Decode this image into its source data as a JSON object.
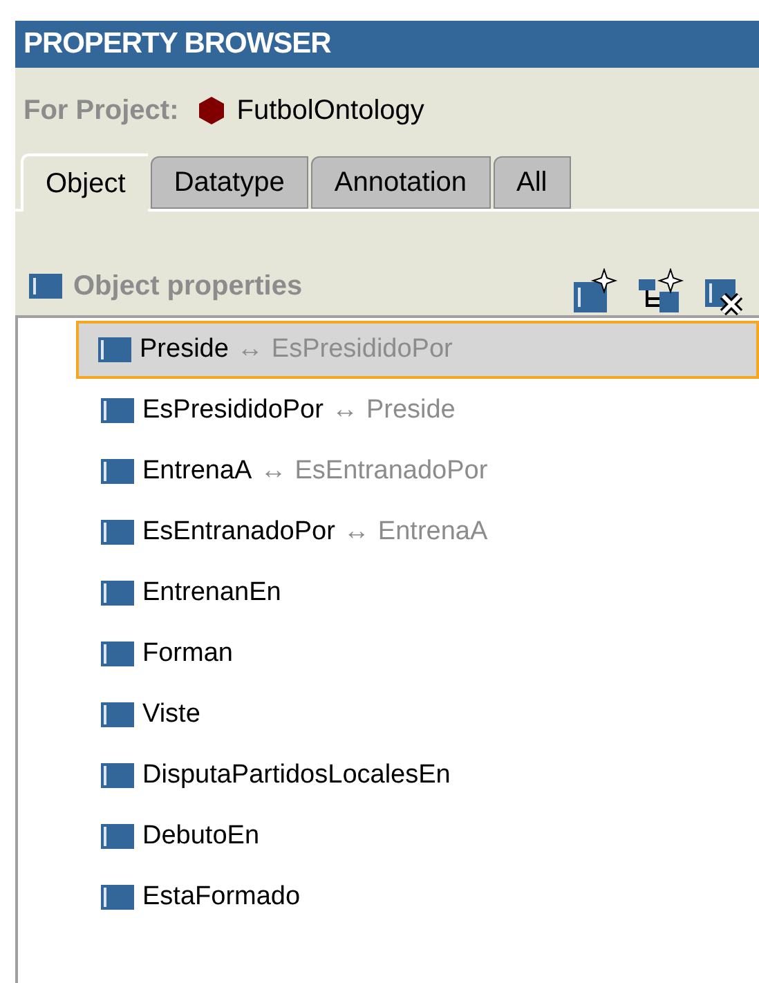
{
  "header": {
    "title": "PROPERTY BROWSER"
  },
  "project": {
    "label": "For Project:",
    "name": "FutbolOntology"
  },
  "tabs": [
    {
      "label": "Object",
      "selected": true
    },
    {
      "label": "Datatype",
      "selected": false
    },
    {
      "label": "Annotation",
      "selected": false
    },
    {
      "label": "All",
      "selected": false
    }
  ],
  "section": {
    "title": "Object properties"
  },
  "properties": [
    {
      "name": "Preside",
      "arrow": "↔",
      "inverse": "EsPresididoPor",
      "selected": true
    },
    {
      "name": "EsPresididoPor",
      "arrow": "↔",
      "inverse": "Preside",
      "selected": false
    },
    {
      "name": "EntrenaA",
      "arrow": "↔",
      "inverse": "EsEntranadoPor",
      "selected": false
    },
    {
      "name": "EsEntranadoPor",
      "arrow": "↔",
      "inverse": "EntrenaA",
      "selected": false
    },
    {
      "name": "EntrenanEn",
      "selected": false
    },
    {
      "name": "Forman",
      "selected": false
    },
    {
      "name": "Viste",
      "selected": false
    },
    {
      "name": "DisputaPartidosLocalesEn",
      "selected": false
    },
    {
      "name": "DebutoEn",
      "selected": false
    },
    {
      "name": "EstaFormado",
      "selected": false
    }
  ]
}
